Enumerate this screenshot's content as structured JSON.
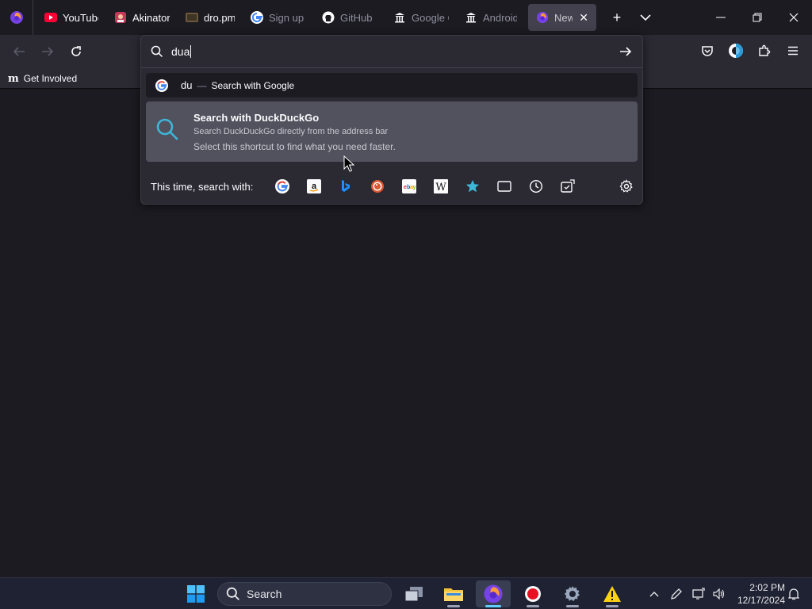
{
  "tabs": [
    {
      "label": "YouTube",
      "icon": "youtube-icon",
      "faded": false
    },
    {
      "label": "Akinator",
      "icon": "akinator-icon",
      "faded": false
    },
    {
      "label": "dro.pm",
      "icon": "dropm-icon",
      "faded": false
    },
    {
      "label": "Sign up",
      "icon": "google-icon",
      "faded": true
    },
    {
      "label": "GitHub",
      "icon": "github-icon",
      "faded": true
    },
    {
      "label": "Google C",
      "icon": "building-icon",
      "faded": true
    },
    {
      "label": "Android",
      "icon": "building-icon",
      "faded": true
    },
    {
      "label": "New T",
      "icon": "firefox-icon",
      "faded": true,
      "active": true
    }
  ],
  "bookmarks": {
    "item": "Get Involved",
    "icon": "m-logo-icon"
  },
  "urlbar": {
    "input_value": "dua",
    "google_row": {
      "query": "du",
      "dash": "—",
      "action": "Search with Google"
    },
    "ddg_row": {
      "title": "Search with DuckDuckGo",
      "subtitle": "Search DuckDuckGo directly from the address bar",
      "hint": "Select this shortcut to find what you need faster."
    },
    "engines_label": "This time, search with:",
    "engines": [
      "google-icon",
      "amazon-icon",
      "bing-icon",
      "duckduckgo-icon",
      "ebay-icon",
      "wikipedia-icon",
      "bookmarks-star-icon",
      "tabs-icon",
      "history-icon",
      "actions-icon"
    ]
  },
  "taskbar": {
    "search_label": "Search",
    "time": "2:02 PM",
    "date": "12/17/2024"
  },
  "colors": {
    "accent": "#60cdff",
    "ddg_icon": "#3eb6d8",
    "firefox": "#7542e5"
  }
}
